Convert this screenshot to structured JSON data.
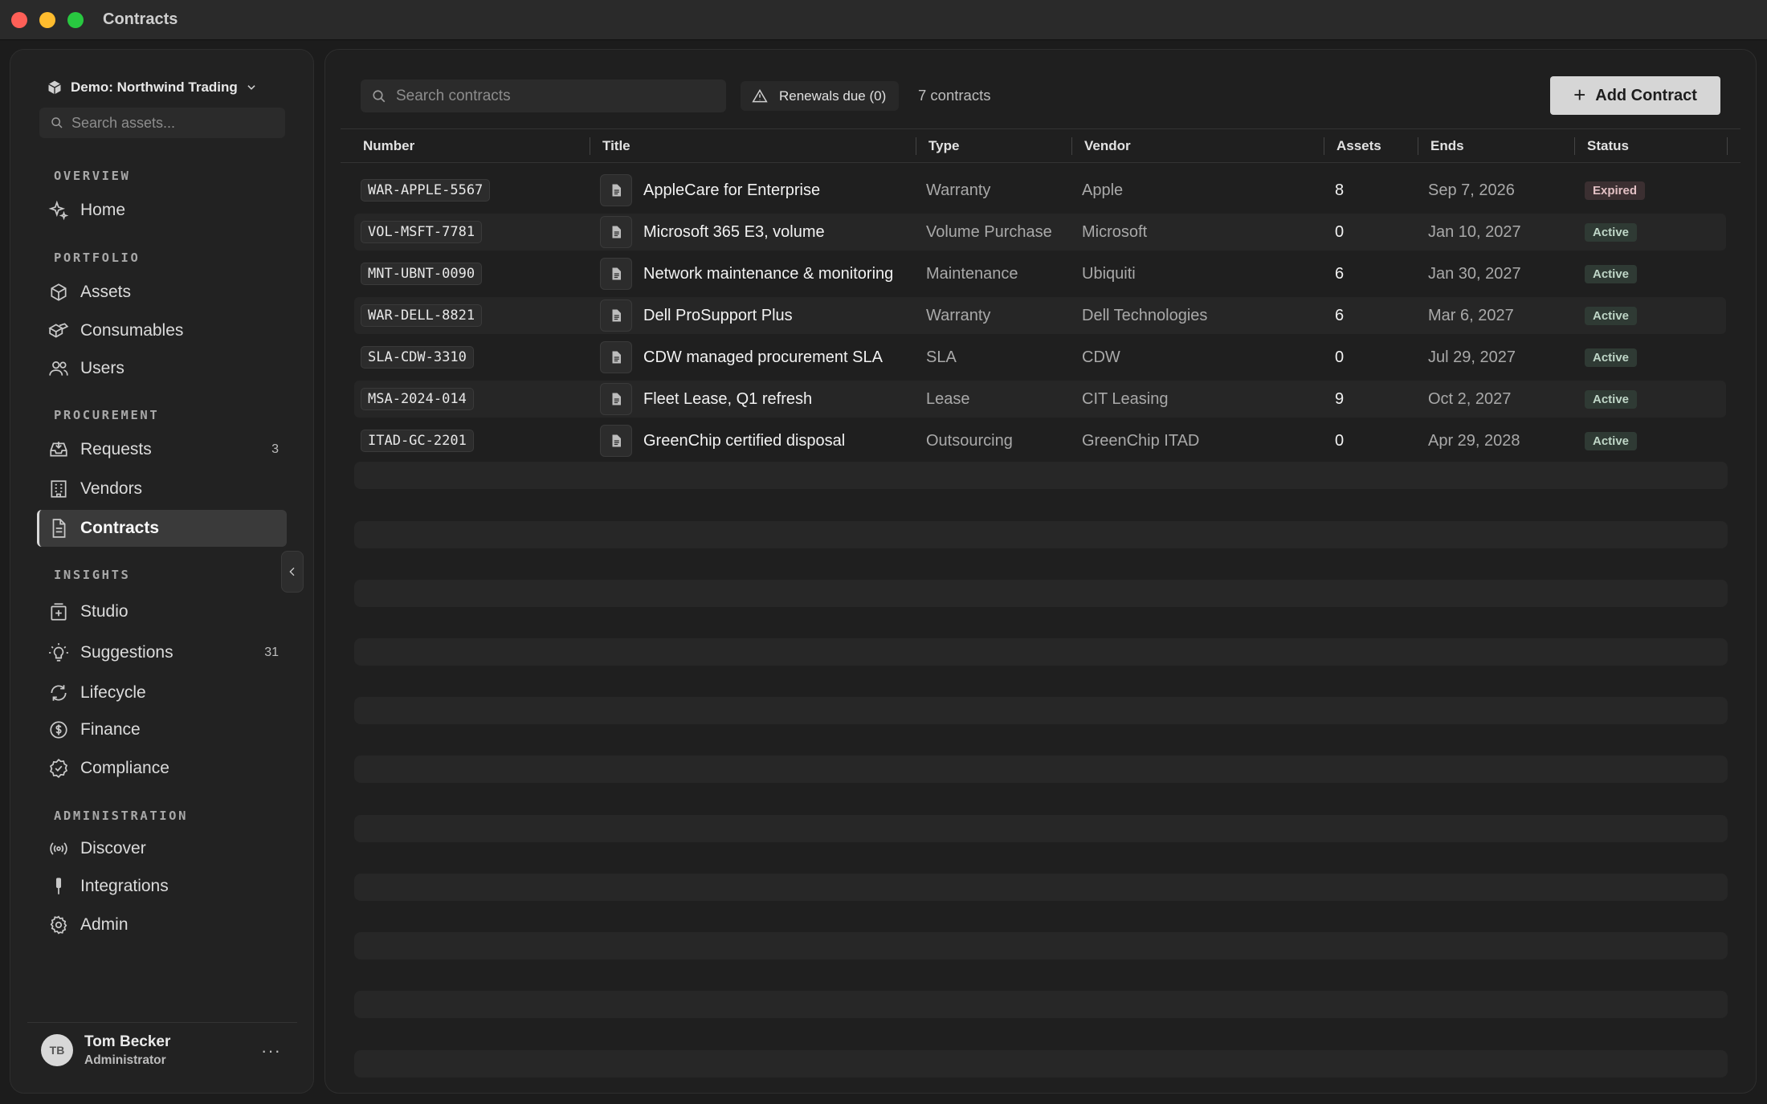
{
  "window": {
    "title": "Contracts"
  },
  "sidebar": {
    "workspace": "Demo: Northwind Trading",
    "search_placeholder": "Search assets...",
    "sections": {
      "overview": "OVERVIEW",
      "portfolio": "PORTFOLIO",
      "procurement": "PROCUREMENT",
      "insights": "INSIGHTS",
      "administration": "ADMINISTRATION"
    },
    "items": {
      "home": "Home",
      "assets": "Assets",
      "consumables": "Consumables",
      "users": "Users",
      "requests": "Requests",
      "requests_count": "3",
      "vendors": "Vendors",
      "contracts": "Contracts",
      "studio": "Studio",
      "suggestions": "Suggestions",
      "suggestions_count": "31",
      "lifecycle": "Lifecycle",
      "finance": "Finance",
      "compliance": "Compliance",
      "discover": "Discover",
      "integrations": "Integrations",
      "admin": "Admin"
    },
    "user": {
      "initials": "TB",
      "name": "Tom Becker",
      "role": "Administrator",
      "menu": "···"
    }
  },
  "toolbar": {
    "search_placeholder": "Search contracts",
    "renewals_label": "Renewals due (0)",
    "count_label": "7 contracts",
    "add_label": "Add Contract"
  },
  "table": {
    "columns": {
      "number": "Number",
      "title": "Title",
      "type": "Type",
      "vendor": "Vendor",
      "assets": "Assets",
      "ends": "Ends",
      "status": "Status"
    },
    "rows": [
      {
        "number": "WAR-APPLE-5567",
        "title": "AppleCare for Enterprise",
        "type": "Warranty",
        "vendor": "Apple",
        "assets": "8",
        "ends": "Sep 7, 2026",
        "status": "Expired"
      },
      {
        "number": "VOL-MSFT-7781",
        "title": "Microsoft 365 E3, volume",
        "type": "Volume Purchase",
        "vendor": "Microsoft",
        "assets": "0",
        "ends": "Jan 10, 2027",
        "status": "Active"
      },
      {
        "number": "MNT-UBNT-0090",
        "title": "Network maintenance & monitoring",
        "type": "Maintenance",
        "vendor": "Ubiquiti",
        "assets": "6",
        "ends": "Jan 30, 2027",
        "status": "Active"
      },
      {
        "number": "WAR-DELL-8821",
        "title": "Dell ProSupport Plus",
        "type": "Warranty",
        "vendor": "Dell Technologies",
        "assets": "6",
        "ends": "Mar 6, 2027",
        "status": "Active"
      },
      {
        "number": "SLA-CDW-3310",
        "title": "CDW managed procurement SLA",
        "type": "SLA",
        "vendor": "CDW",
        "assets": "0",
        "ends": "Jul 29, 2027",
        "status": "Active"
      },
      {
        "number": "MSA-2024-014",
        "title": "Fleet Lease, Q1 refresh",
        "type": "Lease",
        "vendor": "CIT Leasing",
        "assets": "9",
        "ends": "Oct 2, 2027",
        "status": "Active"
      },
      {
        "number": "ITAD-GC-2201",
        "title": "GreenChip certified disposal",
        "type": "Outsourcing",
        "vendor": "GreenChip ITAD",
        "assets": "0",
        "ends": "Apr 29, 2028",
        "status": "Active"
      }
    ]
  },
  "colors": {
    "background": "#1c1c1c",
    "panel": "#1f1f1f",
    "sidebar": "#222222",
    "active_badge": "#2f3a34",
    "expired_badge": "#3b2f31",
    "primary_button": "#d6d6d6"
  }
}
